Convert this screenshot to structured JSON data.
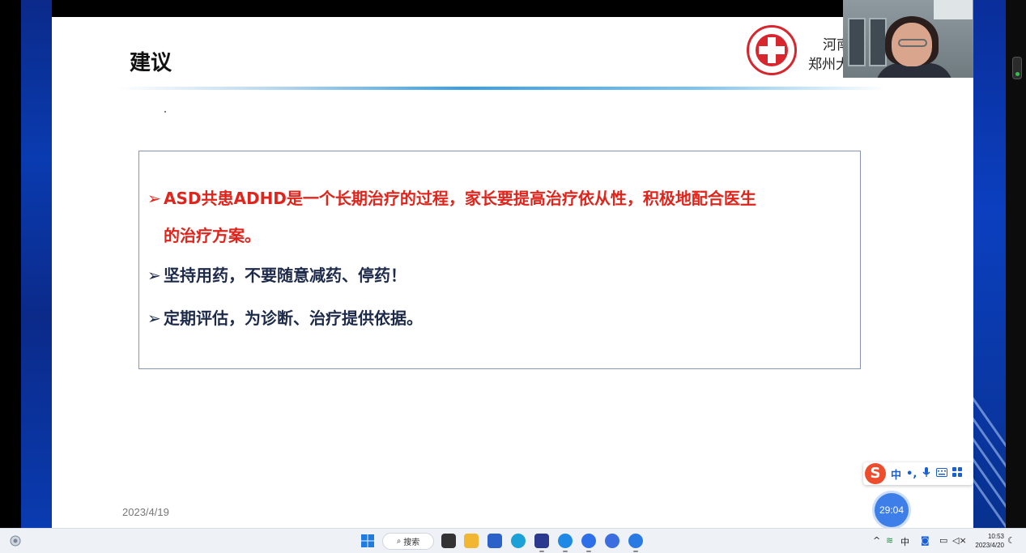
{
  "slide": {
    "title": "建议",
    "org_line1": "河南",
    "org_line2": "郑州大",
    "date": "2023/4/19",
    "bullets": [
      {
        "arrow": "➢",
        "text_line1": "ASD共患ADHD是一个长期治疗的过程，家长要提高治疗依从性，积极地配合医生",
        "text_line2": "的治疗方案。",
        "color": "#e0241b"
      },
      {
        "arrow": "➢",
        "text_line1": "坚持用药，不要随意减药、停药！",
        "color": "#1e2a4a"
      },
      {
        "arrow": "➢",
        "text_line1": "定期评估，为诊断、治疗提供依据。",
        "color": "#1e2a4a"
      }
    ]
  },
  "ime": {
    "logo": "S",
    "mode": "中",
    "punct": "•,",
    "mic": "mic-icon",
    "keyboard": "keyboard-icon",
    "apps": "grid-icon"
  },
  "timer": {
    "value": "29:04"
  },
  "taskbar": {
    "search_label": "搜索",
    "tray_lang": "中",
    "clock_time": "10:53",
    "clock_date": "2023/4/20"
  },
  "colors": {
    "accent_red": "#e0241b",
    "dark_text": "#1e2a4a",
    "taskbar_bg": "#eef2f7",
    "side_blue": "#0a3bb0"
  }
}
